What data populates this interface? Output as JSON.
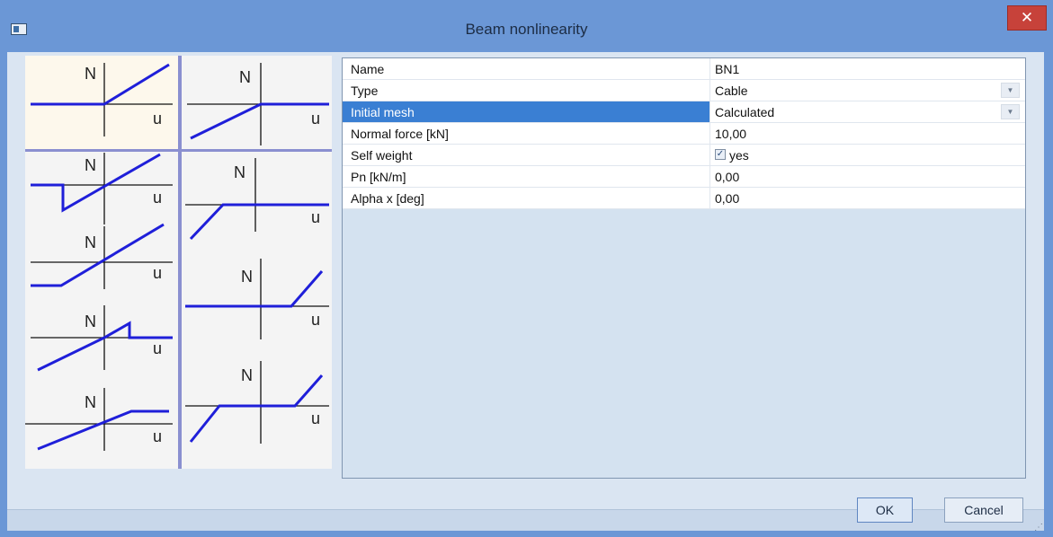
{
  "window": {
    "title": "Beam nonlinearity",
    "close_glyph": "✕"
  },
  "previews": {
    "axis_n": "N",
    "axis_u": "u",
    "curve_color": "#1f1fd9",
    "selected_bg": "#fdf8ec",
    "separator_color": "#8a8fd0"
  },
  "properties": [
    {
      "name": "Name",
      "value": "BN1",
      "kind": "text"
    },
    {
      "name": "Type",
      "value": "Cable",
      "kind": "dropdown"
    },
    {
      "name": "Initial mesh",
      "value": "Calculated",
      "kind": "dropdown",
      "selected": true
    },
    {
      "name": "Normal force [kN]",
      "value": "10,00",
      "kind": "text"
    },
    {
      "name": "Self weight",
      "value": "yes",
      "kind": "checkbox",
      "checked": true
    },
    {
      "name": "Pn [kN/m]",
      "value": "0,00",
      "kind": "text"
    },
    {
      "name": "Alpha x [deg]",
      "value": "0,00",
      "kind": "text"
    }
  ],
  "buttons": {
    "ok": "OK",
    "cancel": "Cancel"
  },
  "icons": {
    "dropdown": "chevron-down-icon",
    "check": "checkmark-icon",
    "grip": "resize-grip-icon"
  }
}
